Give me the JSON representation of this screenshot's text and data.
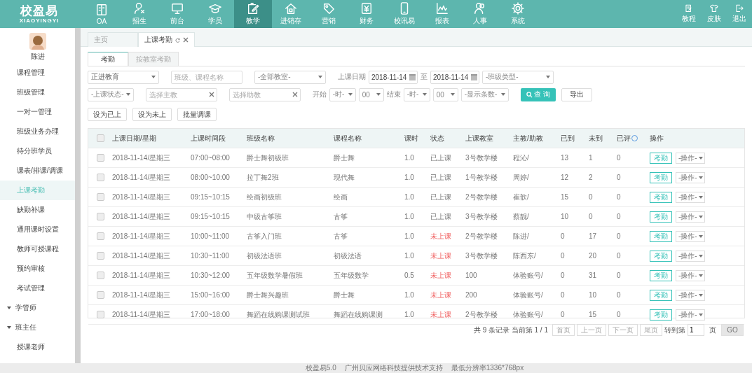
{
  "logo": {
    "title": "校盈易",
    "subtitle": "XIAOYINGYI"
  },
  "nav": [
    {
      "label": "OA",
      "selected": false
    },
    {
      "label": "招生",
      "selected": false
    },
    {
      "label": "前台",
      "selected": false
    },
    {
      "label": "学员",
      "selected": false
    },
    {
      "label": "教学",
      "selected": true
    },
    {
      "label": "进销存",
      "selected": false
    },
    {
      "label": "营销",
      "selected": false
    },
    {
      "label": "财务",
      "selected": false
    },
    {
      "label": "校讯易",
      "selected": false
    },
    {
      "label": "报表",
      "selected": false
    },
    {
      "label": "人事",
      "selected": false
    },
    {
      "label": "系统",
      "selected": false
    }
  ],
  "top_actions": [
    {
      "label": "教程"
    },
    {
      "label": "皮肤"
    },
    {
      "label": "退出"
    }
  ],
  "user": {
    "name": "陈进"
  },
  "sidebar": {
    "items": [
      {
        "kind": "link",
        "label": "课程管理",
        "selected": false
      },
      {
        "kind": "link",
        "label": "班级管理",
        "selected": false
      },
      {
        "kind": "link",
        "label": "一对一管理",
        "selected": false
      },
      {
        "kind": "link",
        "label": "班级业务办理",
        "selected": false
      },
      {
        "kind": "link",
        "label": "待分班学员",
        "selected": false
      },
      {
        "kind": "link",
        "label": "课表/排课/调课",
        "selected": false
      },
      {
        "kind": "link",
        "label": "上课考勤",
        "selected": true
      },
      {
        "kind": "link",
        "label": "缺勤补课",
        "selected": false
      },
      {
        "kind": "link",
        "label": "通用课时设置",
        "selected": false
      },
      {
        "kind": "link",
        "label": "教师可授课程",
        "selected": false
      },
      {
        "kind": "link",
        "label": "预约审核",
        "selected": false
      },
      {
        "kind": "link",
        "label": "考试管理",
        "selected": false
      },
      {
        "kind": "group",
        "label": "学管师",
        "selected": false
      },
      {
        "kind": "group",
        "label": "班主任",
        "selected": false
      },
      {
        "kind": "link",
        "label": "授课老师",
        "selected": false
      }
    ]
  },
  "page_tabs": [
    {
      "label": "主页",
      "selected": false,
      "closable": false
    },
    {
      "label": "上课考勤",
      "selected": true,
      "closable": true
    }
  ],
  "sub_tabs": [
    {
      "label": "考勤",
      "selected": true
    },
    {
      "label": "按教室考勤",
      "selected": false
    }
  ],
  "filters_top": [
    {
      "kind": "select",
      "value": "正进教育"
    },
    {
      "kind": "text",
      "placeholder": "班级、课程名称",
      "clearable": false
    },
    {
      "kind": "select",
      "value": "-全部教室-"
    },
    {
      "kind": "label",
      "text": "上课日期"
    },
    {
      "kind": "date",
      "value": "2018-11-14"
    },
    {
      "kind": "label",
      "text": "至"
    },
    {
      "kind": "date",
      "value": "2018-11-14"
    },
    {
      "kind": "select",
      "value": "-班级类型-"
    }
  ],
  "filters_bottom": [
    {
      "kind": "select",
      "value": "-上课状态-"
    },
    {
      "kind": "text",
      "placeholder": "选择主教",
      "clearable": true
    },
    {
      "kind": "text",
      "placeholder": "选择助教",
      "clearable": true
    },
    {
      "kind": "label",
      "text": "开始"
    },
    {
      "kind": "select",
      "value": "-时-"
    },
    {
      "kind": "select",
      "value": "00"
    },
    {
      "kind": "label",
      "text": "结束"
    },
    {
      "kind": "select",
      "value": "-时-"
    },
    {
      "kind": "select",
      "value": "00"
    },
    {
      "kind": "select",
      "value": "-显示条数-"
    },
    {
      "kind": "primary",
      "text": "查 询"
    },
    {
      "kind": "button",
      "text": "导出"
    }
  ],
  "bulk_actions": [
    "设为已上",
    "设为未上",
    "批量调课"
  ],
  "table": {
    "header_checked": false,
    "columns": [
      {
        "label": "上课日期/星期",
        "help": false
      },
      {
        "label": "上课时间段",
        "help": false
      },
      {
        "label": "班级名称",
        "help": false
      },
      {
        "label": "课程名称",
        "help": false
      },
      {
        "label": "课时",
        "help": false
      },
      {
        "label": "状态",
        "help": false
      },
      {
        "label": "上课教室",
        "help": false
      },
      {
        "label": "主教/助教",
        "help": false
      },
      {
        "label": "已到",
        "help": false
      },
      {
        "label": "未到",
        "help": false
      },
      {
        "label": "已评",
        "help": true
      },
      {
        "label": "操作",
        "help": false
      }
    ],
    "rows": [
      {
        "checked": false,
        "date": "2018-11-14/星期三",
        "time": "07:00~08:00",
        "class_name": "爵士舞初级班",
        "course": "爵士舞",
        "hours": "1.0",
        "status": "已上课",
        "held": true,
        "room": "3号教学楼",
        "teacher": "程沁/",
        "arrived": "13",
        "absent": "1",
        "rated": "0",
        "action_button": "考勤",
        "action_menu": "-操作-"
      },
      {
        "checked": false,
        "date": "2018-11-14/星期三",
        "time": "08:00~10:00",
        "class_name": "拉丁舞2班",
        "course": "现代舞",
        "hours": "1.0",
        "status": "已上课",
        "held": true,
        "room": "1号教学楼",
        "teacher": "周婷/",
        "arrived": "12",
        "absent": "2",
        "rated": "0",
        "action_button": "考勤",
        "action_menu": "-操作-"
      },
      {
        "checked": false,
        "date": "2018-11-14/星期三",
        "time": "09:15~10:15",
        "class_name": "绘画初级班",
        "course": "绘画",
        "hours": "1.0",
        "status": "已上课",
        "held": true,
        "room": "2号教学楼",
        "teacher": "崔歆/",
        "arrived": "15",
        "absent": "0",
        "rated": "0",
        "action_button": "考勤",
        "action_menu": "-操作-"
      },
      {
        "checked": false,
        "date": "2018-11-14/星期三",
        "time": "09:15~10:15",
        "class_name": "中级古筝班",
        "course": "古筝",
        "hours": "1.0",
        "status": "已上课",
        "held": true,
        "room": "3号教学楼",
        "teacher": "蔡靓/",
        "arrived": "10",
        "absent": "0",
        "rated": "0",
        "action_button": "考勤",
        "action_menu": "-操作-"
      },
      {
        "checked": false,
        "date": "2018-11-14/星期三",
        "time": "10:00~11:00",
        "class_name": "古筝入门班",
        "course": "古筝",
        "hours": "1.0",
        "status": "未上课",
        "held": false,
        "room": "2号教学楼",
        "teacher": "陈进/",
        "arrived": "0",
        "absent": "17",
        "rated": "0",
        "action_button": "考勤",
        "action_menu": "-操作-"
      },
      {
        "checked": false,
        "date": "2018-11-14/星期三",
        "time": "10:30~11:00",
        "class_name": "初级法语班",
        "course": "初级法语",
        "hours": "1.0",
        "status": "未上课",
        "held": false,
        "room": "3号教学楼",
        "teacher": "陈西东/",
        "arrived": "0",
        "absent": "20",
        "rated": "0",
        "action_button": "考勤",
        "action_menu": "-操作-"
      },
      {
        "checked": false,
        "date": "2018-11-14/星期三",
        "time": "10:30~12:00",
        "class_name": "五年级数学暑假班",
        "course": "五年级数学",
        "hours": "0.5",
        "status": "未上课",
        "held": false,
        "room": "100",
        "teacher": "体验账号/",
        "arrived": "0",
        "absent": "31",
        "rated": "0",
        "action_button": "考勤",
        "action_menu": "-操作-"
      },
      {
        "checked": false,
        "date": "2018-11-14/星期三",
        "time": "15:00~16:00",
        "class_name": "爵士舞兴趣班",
        "course": "爵士舞",
        "hours": "1.0",
        "status": "未上课",
        "held": false,
        "room": "200",
        "teacher": "体验账号/",
        "arrived": "0",
        "absent": "10",
        "rated": "0",
        "action_button": "考勤",
        "action_menu": "-操作-"
      },
      {
        "checked": false,
        "date": "2018-11-14/星期三",
        "time": "17:00~18:00",
        "class_name": "舞蹈在线购课测试班",
        "course": "舞蹈在线购课测",
        "hours": "1.0",
        "status": "未上课",
        "held": false,
        "room": "2号教学楼",
        "teacher": "体验账号/",
        "arrived": "0",
        "absent": "15",
        "rated": "0",
        "action_button": "考勤",
        "action_menu": "-操作-"
      }
    ]
  },
  "pager": {
    "summary": "共 9 条记录 当前第 1 / 1",
    "buttons": [
      {
        "label": "首页",
        "disabled": true
      },
      {
        "label": "上一页",
        "disabled": true
      },
      {
        "label": "下一页",
        "disabled": true
      },
      {
        "label": "尾页",
        "disabled": true
      }
    ],
    "goto_label": "转到第",
    "page_value": "1",
    "page_unit": "页",
    "go": "GO"
  },
  "footer": [
    "校盈易5.0",
    "广州贝应网络科技提供技术支持",
    "最低分辨率1336*768px"
  ]
}
